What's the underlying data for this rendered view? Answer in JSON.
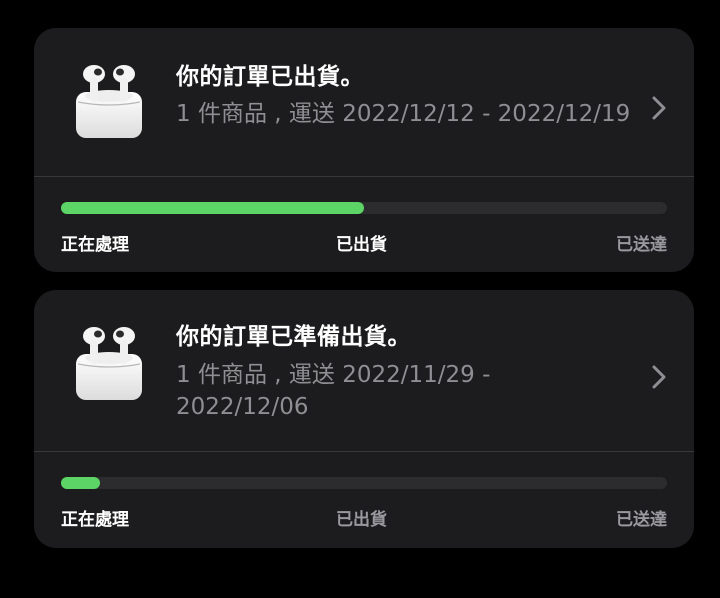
{
  "colors": {
    "background": "#000000",
    "card": "#1c1c1e",
    "progress_fill": "#5dd466",
    "progress_track": "#2c2c2e",
    "title_text": "#ffffff",
    "secondary_text": "#8e8e93"
  },
  "orders": [
    {
      "title": "你的訂單已出貨。",
      "subtitle": "1 件商品 , 運送 2022/12/12 - 2022/12/19",
      "product_icon": "airpods-pro-icon",
      "progress_fraction": 0.5,
      "current_step": 1,
      "steps": [
        "正在處理",
        "已出貨",
        "已送達"
      ]
    },
    {
      "title": "你的訂單已準備出貨。",
      "subtitle": "1 件商品 , 運送 2022/11/29 - 2022/12/06",
      "product_icon": "airpods-pro-icon",
      "progress_fraction": 0.064,
      "current_step": 0,
      "steps": [
        "正在處理",
        "已出貨",
        "已送達"
      ]
    }
  ]
}
